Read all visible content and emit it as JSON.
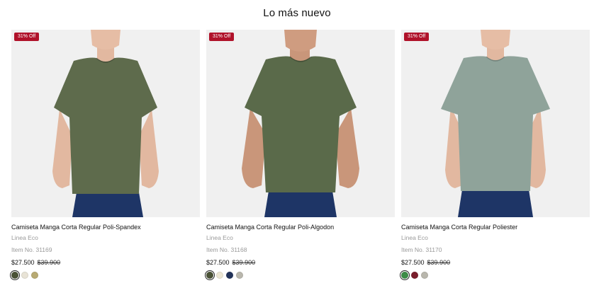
{
  "section": {
    "title": "Lo más nuevo"
  },
  "products": [
    {
      "badge": "31% Off",
      "name": "Camiseta Manga Corta Regular Poli-Spandex",
      "line": "Linea Eco",
      "item_no": "Item No. 31169",
      "price": "$27.500",
      "old_price": "$39.900",
      "shirt_color": "#5e6b4c",
      "swatches": [
        "#4a5236",
        "#e8e3d6",
        "#b8aa72"
      ]
    },
    {
      "badge": "31% Off",
      "name": "Camiseta Manga Corta Regular Poli-Algodon",
      "line": "Linea Eco",
      "item_no": "Item No. 31168",
      "price": "$27.500",
      "old_price": "$39.900",
      "shirt_color": "#5a6a4a",
      "swatches": [
        "#4a5236",
        "#ece6d4",
        "#22335a",
        "#b9b7ad"
      ]
    },
    {
      "badge": "31% Off",
      "name": "Camiseta Manga Corta Regular Poliester",
      "line": "Linea Eco",
      "item_no": "Item No. 31170",
      "price": "$27.500",
      "old_price": "$39.900",
      "shirt_color": "#8fa39a",
      "swatches": [
        "#3c8c46",
        "#7a1e2c",
        "#b9b7ad"
      ]
    }
  ]
}
